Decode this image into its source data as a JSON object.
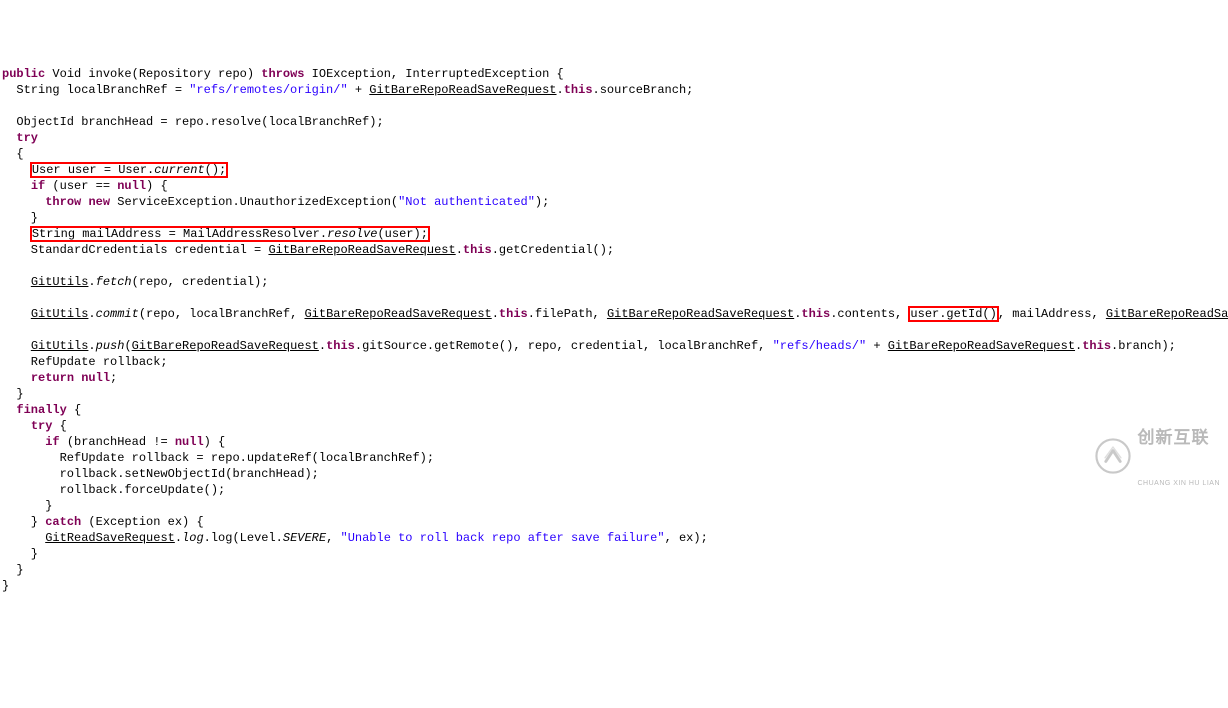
{
  "code": {
    "l1_kw1": "public",
    "l1_type": " Void invoke(Repository repo) ",
    "l1_kw2": "throws",
    "l1_rest": " IOException, InterruptedException {",
    "l2_a": "  String localBranchRef = ",
    "l2_str": "\"refs/remotes/origin/\"",
    "l2_b": " + ",
    "l2_under": "GitBareRepoReadSaveRequest",
    "l2_c": ".",
    "l2_kw": "this",
    "l2_d": ".sourceBranch;",
    "l3": "",
    "l4": "  ObjectId branchHead = repo.resolve(localBranchRef);",
    "l5_kw": "try",
    "l5_pre": "  ",
    "l6": "  {",
    "l7_box": "User user = User.",
    "l7_static": "current",
    "l7_end": "();",
    "l7_pre": "    ",
    "l8_pre": "    ",
    "l8_kw": "if",
    "l8_a": " (user == ",
    "l8_kw2": "null",
    "l8_b": ") {",
    "l9_pre": "      ",
    "l9_kw1": "throw",
    "l9_sp": " ",
    "l9_kw2": "new",
    "l9_a": " ServiceException.UnauthorizedException(",
    "l9_str": "\"Not authenticated\"",
    "l9_b": ");",
    "l10": "    }",
    "l11_pre": "    ",
    "l11_box_a": "String mailAddress = MailAddressResolver.",
    "l11_static": "resolve",
    "l11_box_b": "(user);",
    "l12_pre": "    StandardCredentials credential = ",
    "l12_under": "GitBareRepoReadSaveRequest",
    "l12_a": ".",
    "l12_kw": "this",
    "l12_b": ".getCredential();",
    "l13": "",
    "l14_pre": "    ",
    "l14_under": "GitUtils",
    "l14_a": ".",
    "l14_static": "fetch",
    "l14_b": "(repo, credential);",
    "l15": "",
    "l16_pre": "    ",
    "l16_under1": "GitUtils",
    "l16_a": ".",
    "l16_static": "commit",
    "l16_b": "(repo, localBranchRef, ",
    "l16_under2": "GitBareRepoReadSaveRequest",
    "l16_c": ".",
    "l16_kw1": "this",
    "l16_d": ".filePath, ",
    "l16_under3": "GitBareRepoReadSaveRequest",
    "l16_e": ".",
    "l16_kw2": "this",
    "l16_f": ".contents, ",
    "l16_box": "user.getId()",
    "l16_g": ", mailAddress, ",
    "l16_under4": "GitBareRepoReadSaveRec",
    "l17": "",
    "l18_pre": "    ",
    "l18_under1": "GitUtils",
    "l18_a": ".",
    "l18_static": "push",
    "l18_b": "(",
    "l18_under2": "GitBareRepoReadSaveRequest",
    "l18_c": ".",
    "l18_kw1": "this",
    "l18_d": ".gitSource.getRemote(), repo, credential, localBranchRef, ",
    "l18_str": "\"refs/heads/\"",
    "l18_e": " + ",
    "l18_under3": "GitBareRepoReadSaveRequest",
    "l18_f": ".",
    "l18_kw2": "this",
    "l18_g": ".branch);",
    "l19": "    RefUpdate rollback;",
    "l20_pre": "    ",
    "l20_kw": "return",
    "l20_sp": " ",
    "l20_kw2": "null",
    "l20_a": ";",
    "l21": "  }",
    "l22_pre": "  ",
    "l22_kw": "finally",
    "l22_a": " {",
    "l23_pre": "    ",
    "l23_kw": "try",
    "l23_a": " {",
    "l24_pre": "      ",
    "l24_kw": "if",
    "l24_a": " (branchHead != ",
    "l24_kw2": "null",
    "l24_b": ") {",
    "l25": "        RefUpdate rollback = repo.updateRef(localBranchRef);",
    "l26": "        rollback.setNewObjectId(branchHead);",
    "l27": "        rollback.forceUpdate();",
    "l28": "      }",
    "l29_pre": "    } ",
    "l29_kw": "catch",
    "l29_a": " (Exception ex) {",
    "l30_pre": "      ",
    "l30_under": "GitReadSaveRequest",
    "l30_a": ".",
    "l30_static1": "log",
    "l30_b": ".log(Level.",
    "l30_static2": "SEVERE",
    "l30_c": ", ",
    "l30_str": "\"Unable to roll back repo after save failure\"",
    "l30_d": ", ex);",
    "l31": "    }",
    "l32": "  }",
    "l33": "}"
  },
  "logo": {
    "cn": "创新互联",
    "py": "CHUANG XIN HU LIAN"
  }
}
